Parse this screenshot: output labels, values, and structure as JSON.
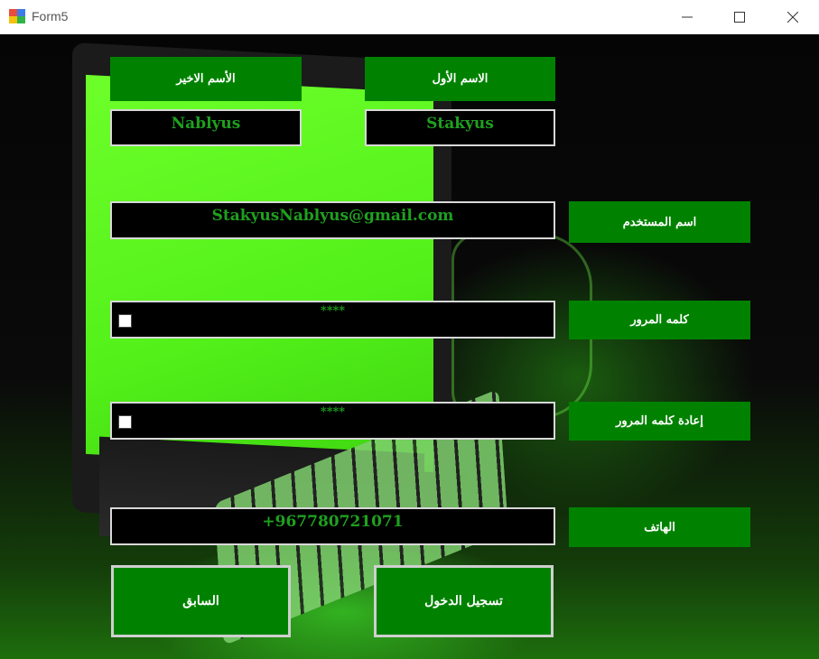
{
  "window": {
    "title": "Form5"
  },
  "labels": {
    "last_name": "الأسم الاخير",
    "first_name": "الاسم الأول",
    "username": "اسم المستخدم",
    "password": "كلمه المرور",
    "confirm_password": "إعادة كلمه المرور",
    "phone": "الهاتف"
  },
  "fields": {
    "last_name": "Nablyus",
    "first_name": "Stakyus",
    "username": "StakyusNablyus@gmail.com",
    "password": "****",
    "confirm_password": "****",
    "phone": "+967780721071"
  },
  "buttons": {
    "previous": "السابق",
    "login": "تسجيل الدخول"
  },
  "colors": {
    "accent": "#008200",
    "field_text": "#1fa01f"
  }
}
